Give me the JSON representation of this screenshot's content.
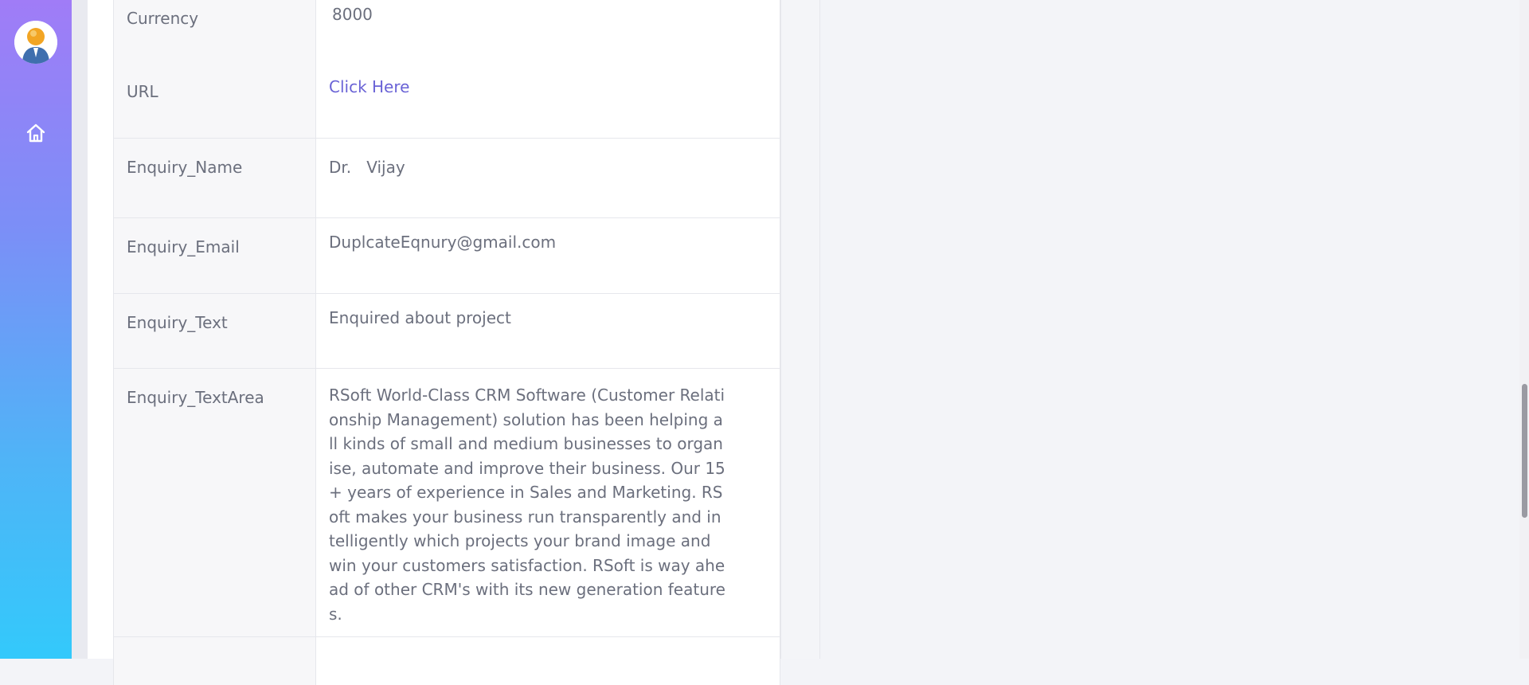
{
  "sidebar": {
    "avatar": "user-avatar",
    "home_icon": "home-icon"
  },
  "details": [
    {
      "label": "Currency",
      "value": "8000"
    },
    {
      "label": "URL",
      "value": "Click Here"
    },
    {
      "label": "Enquiry_Name",
      "value": "Dr.   Vijay"
    },
    {
      "label": "Enquiry_Email",
      "value": "DuplcateEqnury@gmail.com"
    },
    {
      "label": "Enquiry_Text",
      "value": "Enquired about project"
    },
    {
      "label": "Enquiry_TextArea",
      "value": "RSoft World-Class CRM Software (Customer Relationship Management) solution has been helping all kinds of small and medium businesses to organise, automate and improve their business. Our 15+ years of experience in Sales and Marketing. RSoft makes your business run transparently and intelligently which projects your brand image and win your customers satisfaction. RSoft is way ahead of other CRM's with its new generation features."
    }
  ],
  "colors": {
    "sidebar_gradient_top": "#a07cf7",
    "sidebar_gradient_bottom": "#33c9fb",
    "link": "#6a63d6",
    "text": "#6b6f7d"
  }
}
